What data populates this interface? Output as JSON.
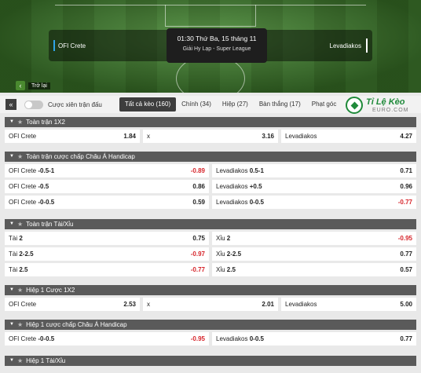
{
  "header": {
    "home_team": "OFI Crete",
    "away_team": "Levadiakos",
    "datetime": "01:30 Thứ Ba, 15 tháng 11",
    "league": "Giải Hy Lạp - Super League",
    "back_label": "Trở lại",
    "back_icon": "chevron-left-icon"
  },
  "filters": {
    "toggle_label": "Cược xiên trận đấu",
    "tabs": [
      "Tất cả kèo (160)",
      "Chính (34)",
      "Hiệp (27)",
      "Bàn thắng (17)",
      "Phạt góc"
    ]
  },
  "logo": {
    "brand": "Tỉ Lệ Kèo",
    "sub": "EURO.COM"
  },
  "colors": {
    "negative_odd": "#d6252b",
    "section_header": "#5a5a5a",
    "accent_green": "#1f8a3a"
  },
  "sections": [
    {
      "title": "Toàn trận 1X2",
      "rows": [
        [
          {
            "label": "OFI Crete",
            "line": "",
            "odd": "1.84"
          },
          {
            "label": "x",
            "line": "",
            "odd": "3.16"
          },
          {
            "label": "Levadiakos",
            "line": "",
            "odd": "4.27"
          }
        ]
      ]
    },
    {
      "title": "Toàn trận cược chấp Châu Á Handicap",
      "rows": [
        [
          {
            "label": "OFI Crete",
            "line": "-0.5-1",
            "odd": "-0.89"
          },
          {
            "label": "Levadiakos",
            "line": "0.5-1",
            "odd": "0.71"
          }
        ],
        [
          {
            "label": "OFI Crete",
            "line": "-0.5",
            "odd": "0.86"
          },
          {
            "label": "Levadiakos",
            "line": "+0.5",
            "odd": "0.96"
          }
        ],
        [
          {
            "label": "OFI Crete",
            "line": "-0-0.5",
            "odd": "0.59"
          },
          {
            "label": "Levadiakos",
            "line": "0-0.5",
            "odd": "-0.77"
          }
        ]
      ]
    },
    {
      "title": "Toàn trận Tài/Xỉu",
      "rows": [
        [
          {
            "label": "Tài",
            "line": "2",
            "odd": "0.75"
          },
          {
            "label": "Xỉu",
            "line": "2",
            "odd": "-0.95"
          }
        ],
        [
          {
            "label": "Tài",
            "line": "2-2.5",
            "odd": "-0.97"
          },
          {
            "label": "Xỉu",
            "line": "2-2.5",
            "odd": "0.77"
          }
        ],
        [
          {
            "label": "Tài",
            "line": "2.5",
            "odd": "-0.77"
          },
          {
            "label": "Xỉu",
            "line": "2.5",
            "odd": "0.57"
          }
        ]
      ]
    },
    {
      "title": "Hiệp 1 Cược 1X2",
      "rows": [
        [
          {
            "label": "OFI Crete",
            "line": "",
            "odd": "2.53"
          },
          {
            "label": "x",
            "line": "",
            "odd": "2.01"
          },
          {
            "label": "Levadiakos",
            "line": "",
            "odd": "5.00"
          }
        ]
      ]
    },
    {
      "title": "Hiệp 1 cược chấp Châu Á Handicap",
      "rows": [
        [
          {
            "label": "OFI Crete",
            "line": "-0-0.5",
            "odd": "-0.95"
          },
          {
            "label": "Levadiakos",
            "line": "0-0.5",
            "odd": "0.77"
          }
        ]
      ]
    },
    {
      "title": "Hiệp 1 Tài/Xỉu",
      "rows": []
    }
  ]
}
